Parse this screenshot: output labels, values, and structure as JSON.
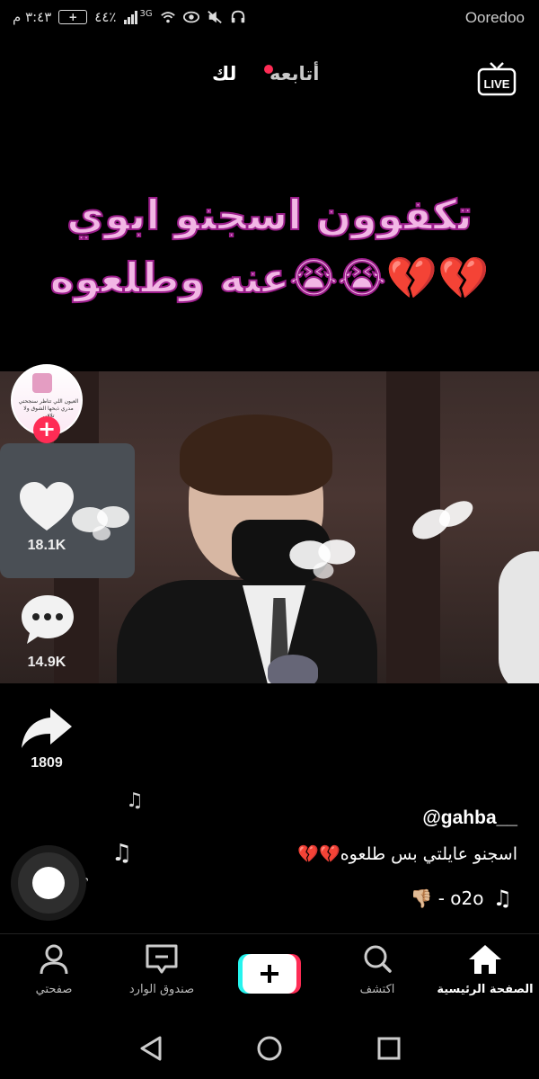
{
  "status_bar": {
    "time": "٣:٤٣ م",
    "battery": "٤٤٪",
    "network": "3G",
    "carrier": "Ooredoo"
  },
  "top_tabs": {
    "live_label": "LIVE",
    "following_label": "أتابعه",
    "for_you_label": "لك"
  },
  "overlay": {
    "line1": "تكفوون اسجنو ابوي",
    "line2": "عنه وطلعوه😭😭💔💔"
  },
  "rail": {
    "avatar_text": "العيون اللي تتاظر سنجحتي مدري ذبحها الشوق ولا تلاقي",
    "likes": "18.1K",
    "comments": "14.9K",
    "shares": "1809"
  },
  "post": {
    "username": "@gahba__",
    "caption": "اسجنو عايلتي بس طلعوه💔💔",
    "music": "👎🏼 - o2o"
  },
  "bottom_nav": {
    "home": "الصفحة الرئيسية",
    "discover": "اكتشف",
    "inbox": "صندوق الوارد",
    "profile": "صفحتي"
  },
  "colors": {
    "accent": "#fe2c55",
    "overlay_text": "#f2b6e5",
    "overlay_stroke": "#9b1e8b"
  },
  "icons": [
    "live-icon",
    "heart-icon",
    "comment-icon",
    "share-icon",
    "music-note-icon",
    "home-icon",
    "search-icon",
    "inbox-icon",
    "profile-icon",
    "plus-icon",
    "back-icon",
    "home-circle-icon",
    "recents-icon"
  ]
}
